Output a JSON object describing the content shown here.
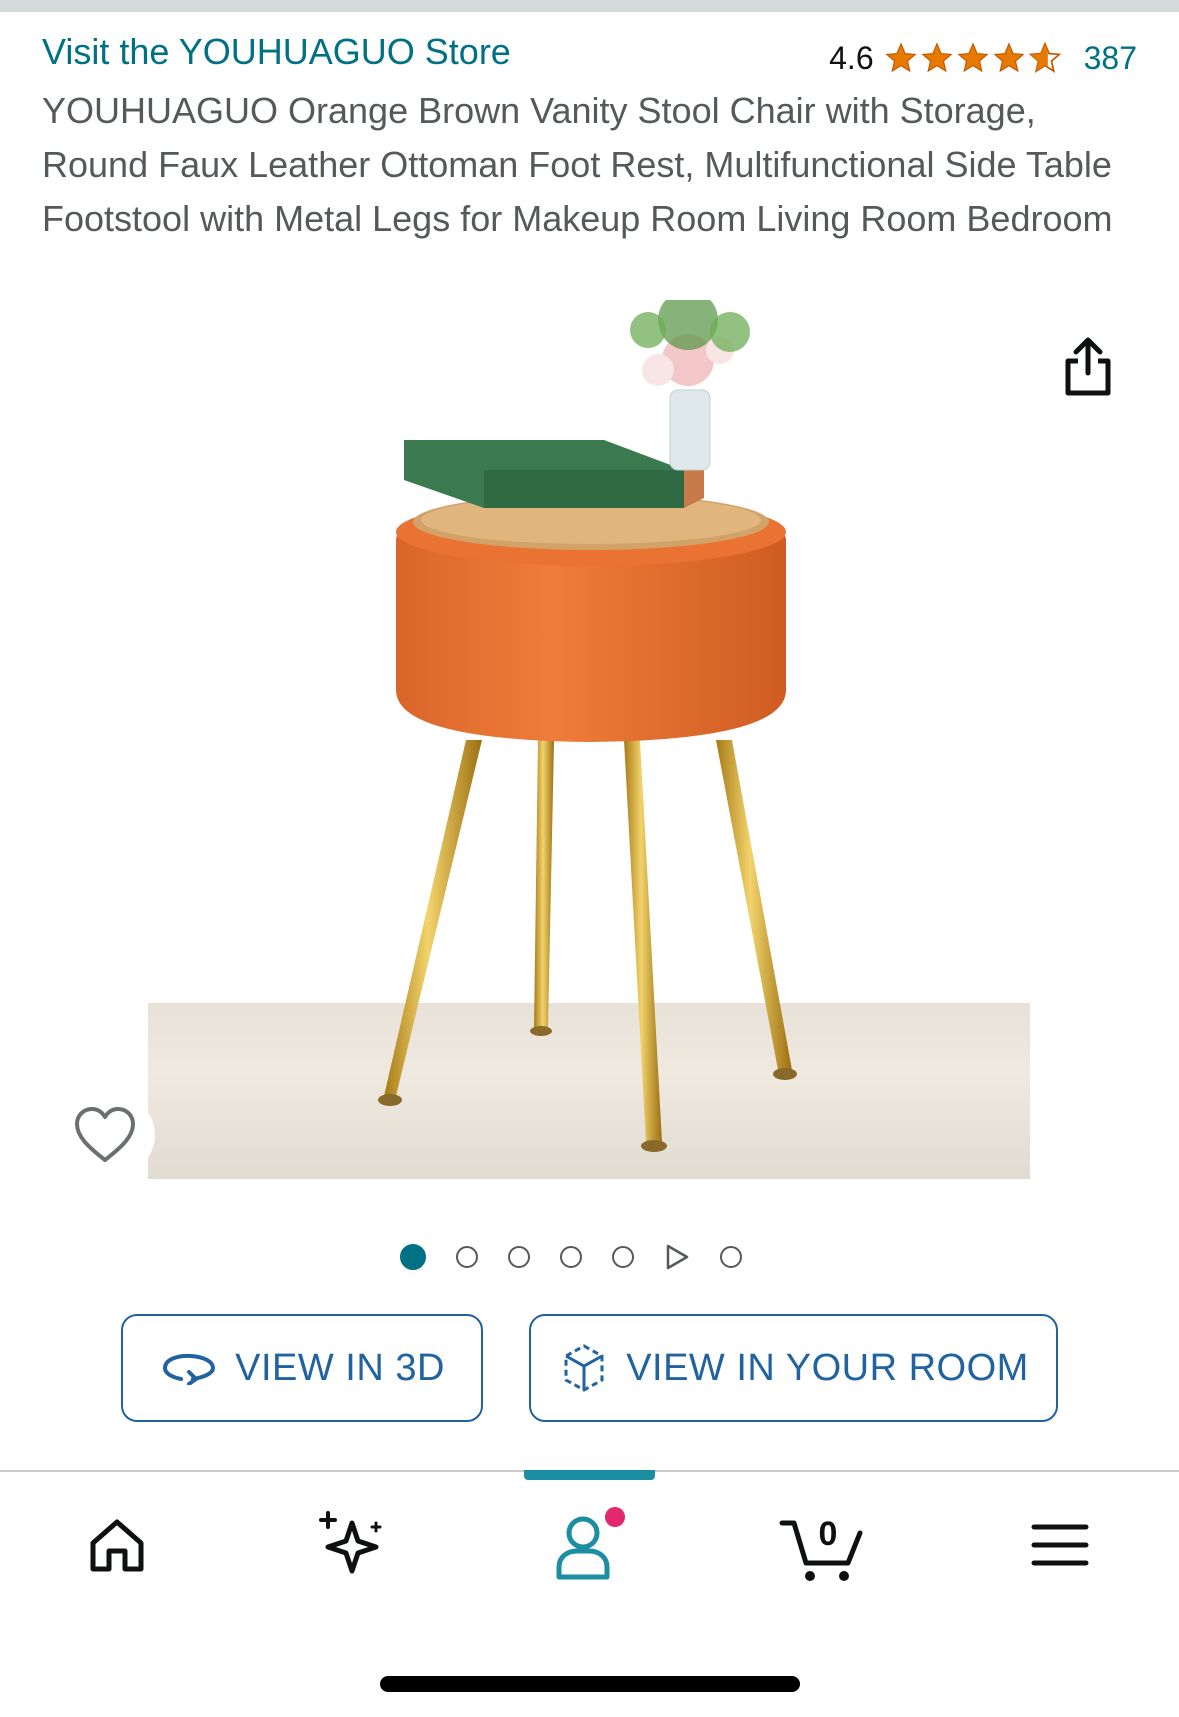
{
  "header": {
    "store_link": "Visit the YOUHUAGUO Store",
    "rating_value": "4.6",
    "rating_stars": 4.6,
    "rating_count": "387",
    "title": "YOUHUAGUO Orange Brown Vanity Stool Chair with Storage, Round Faux Leather Ottoman Foot Rest, Multifunctional Side Table Footstool with Metal Legs for Makeup Room Living Room Bedroom"
  },
  "gallery": {
    "image_subject": "orange round storage stool with wooden lid and gold legs",
    "total_items": 7,
    "active_index": 0,
    "video_index": 5
  },
  "actions": {
    "view_3d": "VIEW IN 3D",
    "view_room": "VIEW IN YOUR ROOM"
  },
  "tabbar": {
    "items": [
      "home-icon",
      "sparkle-icon",
      "account-icon",
      "cart-icon",
      "menu-icon"
    ],
    "active": "account-icon",
    "cart_count": "0"
  },
  "colors": {
    "link": "#007185",
    "star": "#e67a00",
    "button_blue": "#2162a1",
    "notification_dot": "#e3286e",
    "active_tab": "#1b8fa1"
  }
}
